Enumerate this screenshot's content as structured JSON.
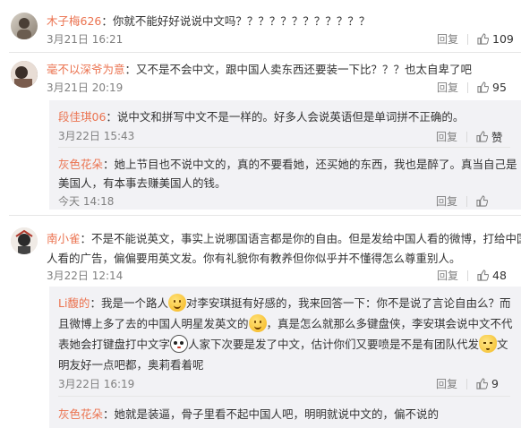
{
  "comments": [
    {
      "user": "木子梅626",
      "text": "：你就不能好好说说中文吗？？？？？？？？？？？？",
      "time": "3月21日 16:21",
      "reply_label": "回复",
      "likes": "109"
    },
    {
      "user": "毫不以深爷为意",
      "text": "：又不是不会中文，跟中国人卖东西还要装一下比？？？也太自卑了吧",
      "time": "3月21日 20:19",
      "reply_label": "回复",
      "likes": "95",
      "replies": [
        {
          "user": "段佳琪06",
          "text": "：说中文和拼写中文不是一样的。好多人会说英语但是单词拼不正确的。",
          "time": "3月22日 15:43",
          "reply_label": "回复",
          "likes": "赞"
        },
        {
          "user": "灰色花朵",
          "line1": "：她上节目也不说中文的，真的不要看她，还买她的东西，我也是醉了。真当自己是",
          "line2": "美国人，有本事去赚美国人的钱。",
          "time": "今天 14:18",
          "reply_label": "回复"
        }
      ]
    },
    {
      "user": "南小雀",
      "line1": "：不是不能说英文，事实上说哪国语言都是你的自由。但是发给中国人看的微博，打给中国",
      "line2": "人看的广告，偏偏要用英文发。你有礼貌你有教养但你似乎并不懂得怎么尊重别人。",
      "time": "3月22日 12:14",
      "reply_label": "回复",
      "likes": "48",
      "replies": [
        {
          "user": "Li馥的",
          "line1a": "：我是一个路人",
          "line1b": "对李安琪挺有好感的，我来回答一下：你不是说了言论自由么？而",
          "line2a": "且微博上多了去的中国人明星发英文的",
          "line2b": "，真是怎么就那么多键盘侠，李安琪会说中文不代",
          "line3a": "表她会打键盘打中文字",
          "line3b": "人家下次要是发了中文，估计你们又要喷是不是有团队代发",
          "line3c": "文",
          "line4": "明友好一点吧都，奥莉看着呢",
          "time": "3月22日 16:19",
          "reply_label": "回复",
          "likes": "9"
        },
        {
          "user": "灰色花朵",
          "text": "：她就是装逼，骨子里看不起中国人吧，明明就说中文的，偏不说的"
        }
      ]
    }
  ]
}
